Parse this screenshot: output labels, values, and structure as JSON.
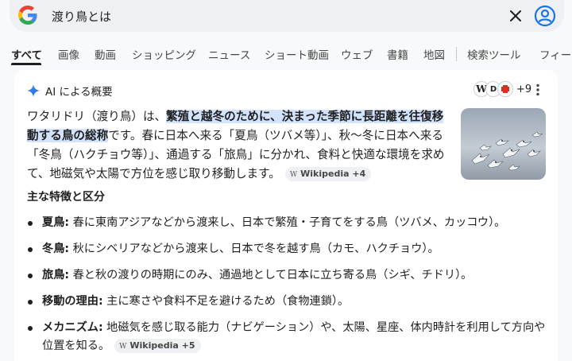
{
  "search": {
    "query": "渡り鳥とは",
    "logo_icon": "google-g-icon"
  },
  "tabs": [
    {
      "label": "すべて",
      "active": true
    },
    {
      "label": "画像"
    },
    {
      "label": "動画"
    },
    {
      "label": "ショッピング"
    },
    {
      "label": "ニュース"
    },
    {
      "label": "ショート動画"
    },
    {
      "label": "ウェブ"
    },
    {
      "label": "書籍"
    },
    {
      "label": "地図"
    },
    {
      "label": "検索ツール"
    },
    {
      "label": "フィード"
    }
  ],
  "ai_overview": {
    "title": "AI による概要",
    "sources_count": "+9",
    "source_icons": [
      "W",
      "D"
    ],
    "intro": {
      "p1": "ワタリドリ（渡り鳥）は、",
      "highlight": "繁殖と越冬のために、決まった季節に長距離を往復移動する鳥の総称",
      "p2": "です。春に日本へ来る「夏鳥（ツバメ等）」、秋〜冬に日本へ来る「冬鳥（ハクチョウ等）」、通過する「旅鳥」に分かれ、食料と快適な環境を求めて、地磁気や太陽で方位を感じ取り移動します。",
      "chip": "Wikipedia +4"
    },
    "subheading": "主な特徴と区分",
    "bullets": [
      {
        "term": "夏鳥:",
        "text": " 春に東南アジアなどから渡来し、日本で繁殖・子育てをする鳥（ツバメ、カッコウ）。"
      },
      {
        "term": "冬鳥:",
        "text": " 秋にシベリアなどから渡来し、日本で冬を越す鳥（カモ、ハクチョウ）。"
      },
      {
        "term": "旅鳥:",
        "text": " 春と秋の渡りの時期にのみ、通過地として日本に立ち寄る鳥（シギ、チドリ）。"
      },
      {
        "term": "移動の理由:",
        "text": " 主に寒さや食料不足を避けるため（食物連鎖）。"
      },
      {
        "term": "メカニズム:",
        "text": " 地磁気を感じ取る能力（ナビゲーション）や、太陽、星座、体内時計を利用して方向や位置を知る。",
        "chip": "Wikipedia +5"
      }
    ]
  },
  "colors": {
    "highlight": "#d3e3fd",
    "card_bg": "#ffffff",
    "page_bg": "#f8f9fb",
    "searchbar_bg": "#eef0f4",
    "accent_blue": "#1a73e8"
  }
}
